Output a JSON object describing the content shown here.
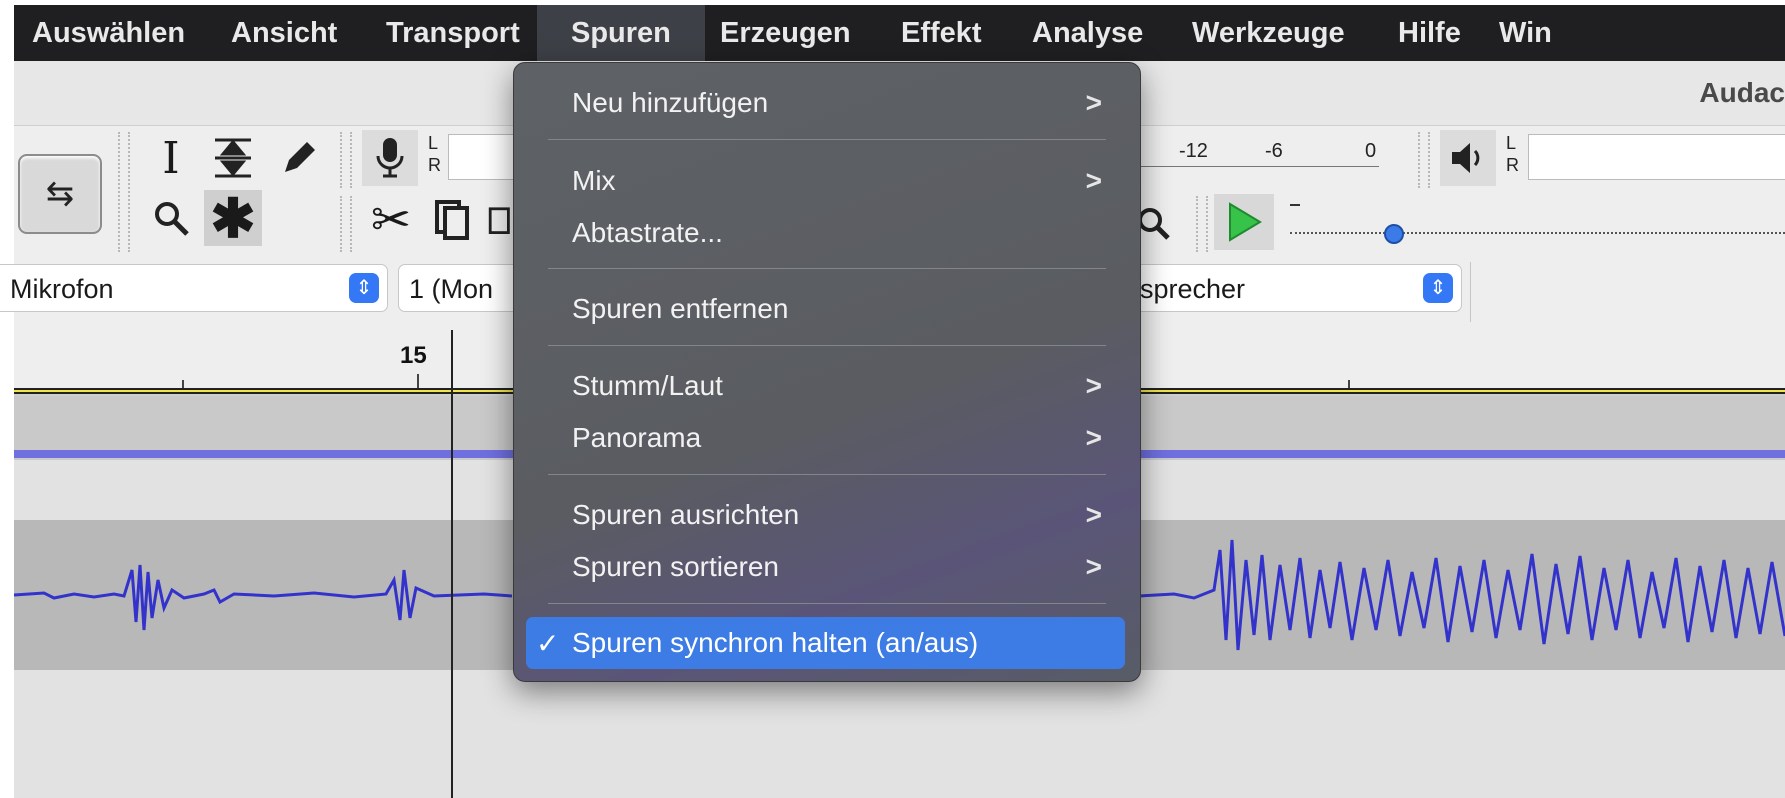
{
  "menubar": {
    "items": [
      "Auswählen",
      "Ansicht",
      "Transport",
      "Spuren",
      "Erzeugen",
      "Effekt",
      "Analyse",
      "Werkzeuge",
      "Hilfe",
      "Win"
    ],
    "active": "Spuren"
  },
  "app_title": "Audac",
  "meters": {
    "rec_lr": [
      "L",
      "R"
    ],
    "play_lr": [
      "L",
      "R"
    ],
    "scale": [
      "-12",
      "-6",
      "0"
    ]
  },
  "devices": {
    "input": "Mikrofon",
    "channels": "1 (Mon",
    "output": "sprecher"
  },
  "ruler": {
    "tick_label": "15"
  },
  "menu": {
    "items": [
      {
        "label": "Neu hinzufügen",
        "submenu": true
      },
      {
        "label": "Mix",
        "submenu": true
      },
      {
        "label": "Abtastrate...",
        "submenu": false
      },
      {
        "label": "Spuren entfernen",
        "submenu": false
      },
      {
        "label": "Stumm/Laut",
        "submenu": true
      },
      {
        "label": "Panorama",
        "submenu": true
      },
      {
        "label": "Spuren ausrichten",
        "submenu": true
      },
      {
        "label": "Spuren sortieren",
        "submenu": true
      },
      {
        "label": "Spuren synchron halten (an/aus)",
        "submenu": false,
        "checked": true
      }
    ],
    "chevron": ">",
    "check": "✓"
  },
  "colors": {
    "menubar_bg": "#1f1f21",
    "menu_bg": "#5e6266",
    "highlight": "#3c7ce4",
    "waveform": "#3333cc",
    "track_line": "#6f6fe0"
  },
  "icons": [
    "loop-icon",
    "ibeam-icon",
    "envelope-icon",
    "pencil-icon",
    "zoom-icon",
    "multi-tool-icon",
    "microphone-icon",
    "cut-icon",
    "copy-icon",
    "paste-icon",
    "fit-zoom-icon",
    "play-icon",
    "speaker-icon"
  ]
}
